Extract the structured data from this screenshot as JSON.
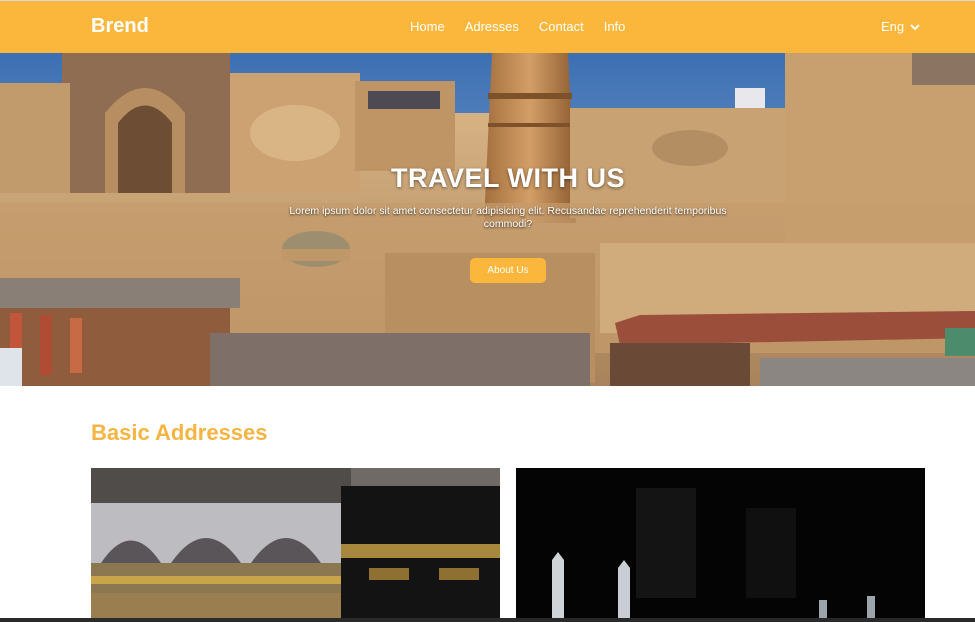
{
  "header": {
    "brand": "Brend",
    "nav": [
      "Home",
      "Adresses",
      "Contact",
      "Info"
    ],
    "language": "Eng"
  },
  "hero": {
    "title": "TRAVEL WITH US",
    "text": "Lorem ipsum dolor sit amet consectetur adipisicing elit. Recusandae reprehenderit temporibus commodi?",
    "button": "About Us"
  },
  "section": {
    "title": "Basic Addresses"
  },
  "colors": {
    "accent": "#fbb73c",
    "title": "#f6b443"
  }
}
